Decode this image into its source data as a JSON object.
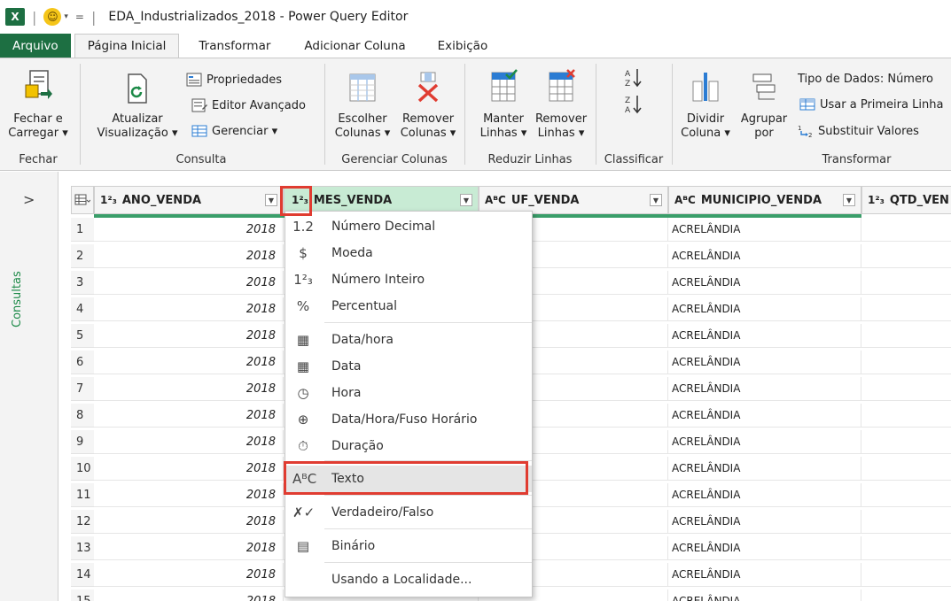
{
  "titlebar": {
    "app_letter": "X",
    "quick_caret": "▾",
    "quick_eq": "=",
    "title": "EDA_Industrializados_2018 - Power Query Editor"
  },
  "tabs": [
    {
      "label": "Arquivo"
    },
    {
      "label": "Página Inicial"
    },
    {
      "label": "Transformar"
    },
    {
      "label": "Adicionar Coluna"
    },
    {
      "label": "Exibição"
    }
  ],
  "ribbon": {
    "fechar": {
      "btn_line1": "Fechar e",
      "btn_line2": "Carregar ▾",
      "group": "Fechar"
    },
    "consulta": {
      "atualizar_line1": "Atualizar",
      "atualizar_line2": "Visualização ▾",
      "propriedades": "Propriedades",
      "editor": "Editor Avançado",
      "gerenciar": "Gerenciar ▾",
      "group": "Consulta"
    },
    "gerenciar_colunas": {
      "escolher_line1": "Escolher",
      "escolher_line2": "Colunas ▾",
      "remover_line1": "Remover",
      "remover_line2": "Colunas ▾",
      "group": "Gerenciar Colunas"
    },
    "reduzir": {
      "manter_line1": "Manter",
      "manter_line2": "Linhas ▾",
      "remover_line1": "Remover",
      "remover_line2": "Linhas ▾",
      "group": "Reduzir Linhas"
    },
    "classificar": {
      "group": "Classificar"
    },
    "transformar": {
      "dividir_line1": "Dividir",
      "dividir_line2": "Coluna ▾",
      "agrupar_line1": "Agrupar",
      "agrupar_line2": "por",
      "tipo": "Tipo de Dados: Número",
      "primeira": "Usar a Primeira Linha",
      "substituir": "Substituir Valores",
      "group": "Transformar"
    }
  },
  "leftpanel": {
    "chevron": ">",
    "label": "Consultas"
  },
  "columns": [
    {
      "type": "1²₃",
      "name": "ANO_VENDA"
    },
    {
      "type": "1²₃",
      "name": "MES_VENDA"
    },
    {
      "type": "AᴮC",
      "name": "UF_VENDA"
    },
    {
      "type": "AᴮC",
      "name": "MUNICIPIO_VENDA"
    },
    {
      "type": "1²₃",
      "name": "QTD_VEN"
    }
  ],
  "rows": [
    {
      "n": "1",
      "ano": "2018",
      "mun": "ACRELÂNDIA"
    },
    {
      "n": "2",
      "ano": "2018",
      "mun": "ACRELÂNDIA"
    },
    {
      "n": "3",
      "ano": "2018",
      "mun": "ACRELÂNDIA"
    },
    {
      "n": "4",
      "ano": "2018",
      "mun": "ACRELÂNDIA"
    },
    {
      "n": "5",
      "ano": "2018",
      "mun": "ACRELÂNDIA"
    },
    {
      "n": "6",
      "ano": "2018",
      "mun": "ACRELÂNDIA"
    },
    {
      "n": "7",
      "ano": "2018",
      "mun": "ACRELÂNDIA"
    },
    {
      "n": "8",
      "ano": "2018",
      "mun": "ACRELÂNDIA"
    },
    {
      "n": "9",
      "ano": "2018",
      "mun": "ACRELÂNDIA"
    },
    {
      "n": "10",
      "ano": "2018",
      "mun": "ACRELÂNDIA"
    },
    {
      "n": "11",
      "ano": "2018",
      "mun": "ACRELÂNDIA"
    },
    {
      "n": "12",
      "ano": "2018",
      "mun": "ACRELÂNDIA"
    },
    {
      "n": "13",
      "ano": "2018",
      "mun": "ACRELÂNDIA"
    },
    {
      "n": "14",
      "ano": "2018",
      "mun": "ACRELÂNDIA"
    },
    {
      "n": "15",
      "ano": "2018",
      "mun": "ACRELÂNDIA"
    }
  ],
  "menu": [
    {
      "icon": "1.2",
      "label": "Número Decimal"
    },
    {
      "icon": "$",
      "label": "Moeda"
    },
    {
      "icon": "1²₃",
      "label": "Número Inteiro"
    },
    {
      "icon": "%",
      "label": "Percentual"
    },
    {
      "icon": "▦",
      "label": "Data/hora"
    },
    {
      "icon": "▦",
      "label": "Data"
    },
    {
      "icon": "◷",
      "label": "Hora"
    },
    {
      "icon": "⊕",
      "label": "Data/Hora/Fuso Horário"
    },
    {
      "icon": "⏱",
      "label": "Duração"
    },
    {
      "icon": "AᴮC",
      "label": "Texto"
    },
    {
      "icon": "✗✓",
      "label": "Verdadeiro/Falso"
    },
    {
      "icon": "▤",
      "label": "Binário"
    },
    {
      "icon": "",
      "label": "Usando a Localidade..."
    }
  ],
  "colors": {
    "excel_green": "#1d6f42",
    "highlight_red": "#e03c31",
    "selected_col": "#c8ebd4"
  }
}
